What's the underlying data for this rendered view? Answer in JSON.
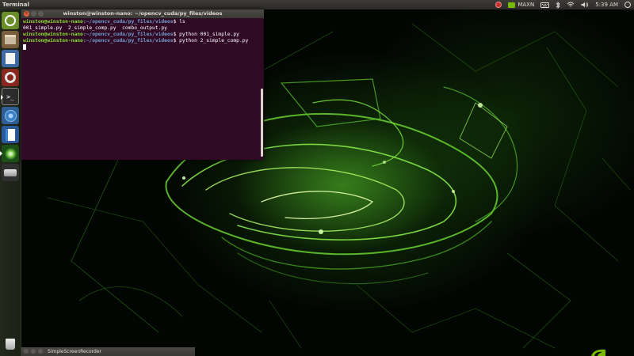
{
  "top_panel": {
    "title": "Terminal",
    "tray": {
      "update_icon": "shield-icon",
      "nvidia_icon": "nvidia-icon",
      "power_mode": "MAXN",
      "keyboard_icon": "keyboard-icon",
      "bluetooth_icon": "bluetooth-icon",
      "network_icon": "network-icon",
      "volume_icon": "volume-icon",
      "time": "5:39 AM",
      "power_icon": "power-icon"
    }
  },
  "launcher": {
    "items": [
      {
        "name": "dash",
        "icon": "ubuntu-logo-icon"
      },
      {
        "name": "files",
        "icon": "folder-icon"
      },
      {
        "name": "document-viewer",
        "icon": "document-icon"
      },
      {
        "name": "system-settings",
        "icon": "gear-icon"
      },
      {
        "name": "terminal",
        "icon": "terminal-icon",
        "label": ">_"
      },
      {
        "name": "chromium",
        "icon": "browser-icon"
      },
      {
        "name": "text-editor",
        "icon": "text-editor-icon"
      },
      {
        "name": "nvidia-app",
        "icon": "nvidia-globe-icon"
      },
      {
        "name": "drive",
        "icon": "drive-icon"
      },
      {
        "name": "trash",
        "icon": "trash-icon"
      }
    ]
  },
  "terminal_window": {
    "title": "winston@winston-nano: ~/opencv_cuda/py_files/videos",
    "close_glyph": "×",
    "lines": [
      {
        "user": "winston@winston-nano",
        "path": ":~/opencv_cuda/py_files/videos",
        "cmd": "$ ls"
      },
      {
        "output": "001_simple.py  2_simple_comp.py  combo_output.py"
      },
      {
        "user": "winston@winston-nano",
        "path": ":~/opencv_cuda/py_files/videos",
        "cmd": "$ python 001_simple.py"
      },
      {
        "user": "winston@winston-nano",
        "path": ":~/opencv_cuda/py_files/videos",
        "cmd": "$ python 2_simple_comp.py"
      }
    ]
  },
  "recorder_window": {
    "title": "SimpleScreenRecorder"
  },
  "colors": {
    "terminal_bg": "#300a24",
    "prompt_user": "#8ae234",
    "prompt_path": "#729fcf",
    "nvidia_green": "#76b900"
  }
}
